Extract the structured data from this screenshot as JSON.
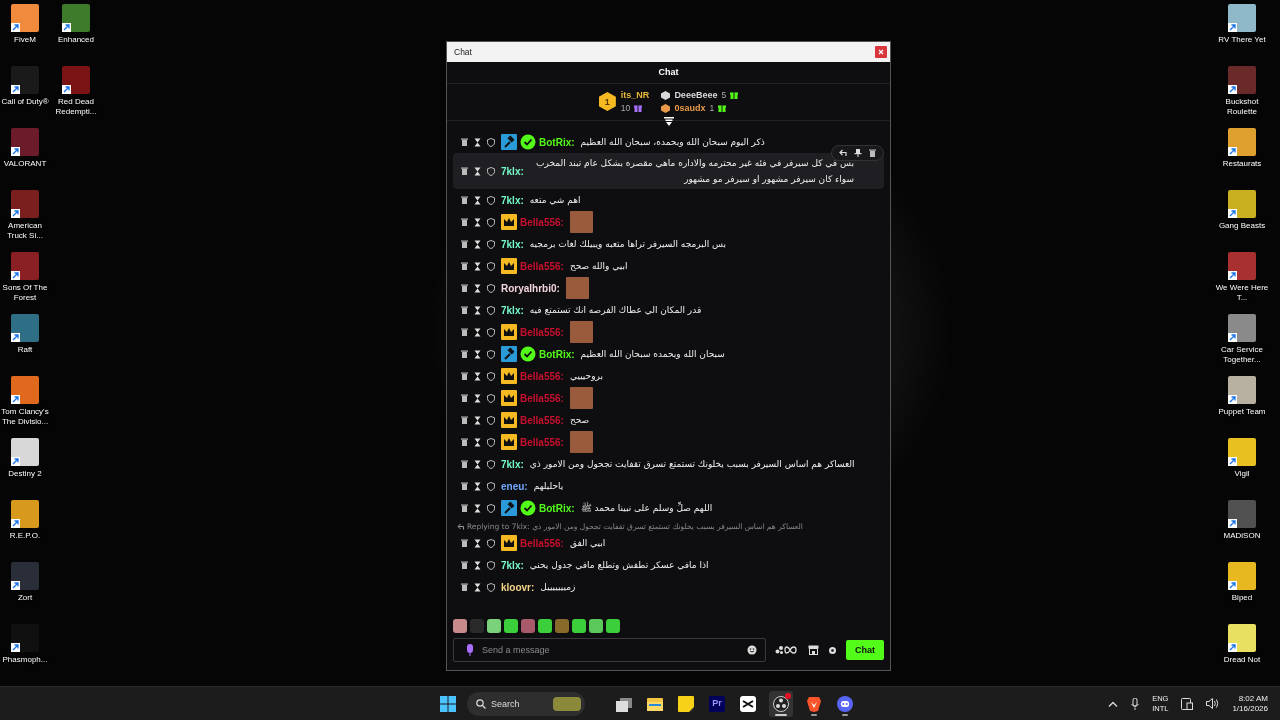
{
  "desktop": {
    "left_columns": [
      [
        {
          "label": "FiveM",
          "color": "#f08a3c"
        },
        {
          "label": "Call of Duty®",
          "color": "#1a1a1a"
        },
        {
          "label": "VALORANT",
          "color": "#6b1b2a"
        },
        {
          "label": "American Truck Si...",
          "color": "#7a1e1e"
        },
        {
          "label": "Sons Of The Forest",
          "color": "#8a1f24"
        },
        {
          "label": "Raft",
          "color": "#2e6f86"
        },
        {
          "label": "Tom Clancy's The Divisio...",
          "color": "#e0691e"
        },
        {
          "label": "Destiny 2",
          "color": "#d8d8d8"
        },
        {
          "label": "R.E.P.O.",
          "color": "#d89a1c"
        },
        {
          "label": "Zort",
          "color": "#2a2e38"
        },
        {
          "label": "Phasmoph...",
          "color": "#101010"
        }
      ],
      [
        {
          "label": "Enhanced",
          "color": "#3d7a2a"
        },
        {
          "label": "Red Dead Redempti...",
          "color": "#7a1414"
        }
      ]
    ],
    "right_column": [
      {
        "label": "RV There Yet",
        "color": "#8fb8c8"
      },
      {
        "label": "Buckshot Roulette",
        "color": "#6a2a2a"
      },
      {
        "label": "Restaurats",
        "color": "#e0a030"
      },
      {
        "label": "Gang Beasts",
        "color": "#c8b020"
      },
      {
        "label": "We Were Here T...",
        "color": "#a83030"
      },
      {
        "label": "Car Service Together...",
        "color": "#8a8a8a"
      },
      {
        "label": "Puppet Team",
        "color": "#b8b0a0"
      },
      {
        "label": "Vigil",
        "color": "#e8c020"
      },
      {
        "label": "MADiSON",
        "color": "#505050"
      },
      {
        "label": "Biped",
        "color": "#e8b820"
      },
      {
        "label": "Dread Not",
        "color": "#e8e060"
      }
    ]
  },
  "chat_window": {
    "title": "Chat",
    "heading": "Chat",
    "leaderboard": {
      "first": {
        "rank": "1",
        "name": "its_NR",
        "count": "10"
      },
      "others": [
        {
          "name": "DeeeBeee",
          "count": "5",
          "color": "#d8d8d8"
        },
        {
          "name": "0saudx",
          "count": "1",
          "color": "#e89a4a"
        }
      ]
    },
    "messages": [
      {
        "name": "BotRix:",
        "color": "#53fc18",
        "mod": true,
        "verified": true,
        "text": "ذكر اليوم سبحان الله وبحمده، سبحان الله العظيم"
      },
      {
        "name": "7klx:",
        "color": "#75fbc9",
        "text": "بس في كل سيرفر في فئه غير محترمه والاداره ماهي مقصره بشكل عام تبند المخرب سواء كان سيرفر مشهور او سيرفر مو مشهور",
        "hovered": true
      },
      {
        "name": "7klx:",
        "color": "#75fbc9",
        "text": "اهم شي متعه"
      },
      {
        "name": "Bella556:",
        "color": "#c8102e",
        "crown": true,
        "emote": true
      },
      {
        "name": "7klx:",
        "color": "#75fbc9",
        "text": "بس البرمجه السيرفر تراها متعبه ويبيلك لغات برمجيه"
      },
      {
        "name": "Bella556:",
        "color": "#c8102e",
        "crown": true,
        "text": "ابيي والله صحح"
      },
      {
        "name": "Roryalhrbi0:",
        "color": "#f2d4dc",
        "emote": true
      },
      {
        "name": "7klx:",
        "color": "#75fbc9",
        "text": "قدر المكان الي عطاك الفرصه انك تستمتع فيه"
      },
      {
        "name": "Bella556:",
        "color": "#c8102e",
        "crown": true,
        "emote": true
      },
      {
        "name": "BotRix:",
        "color": "#53fc18",
        "mod": true,
        "verified": true,
        "text": "سبحان الله وبحمده سبحان الله العظيم"
      },
      {
        "name": "Bella556:",
        "color": "#c8102e",
        "crown": true,
        "text": "بروحيييي"
      },
      {
        "name": "Bella556:",
        "color": "#c8102e",
        "crown": true,
        "emote": true
      },
      {
        "name": "Bella556:",
        "color": "#c8102e",
        "crown": true,
        "text": "صحح"
      },
      {
        "name": "Bella556:",
        "color": "#c8102e",
        "crown": true,
        "emote": true
      },
      {
        "name": "7klx:",
        "color": "#75fbc9",
        "text": "العساكر هم اساس السيرفر بسبب يخلونك تستمتع تسرق تقفايت تجحول ومن الامور ذي"
      },
      {
        "name": "eneu:",
        "color": "#6ea8fe",
        "text": "ياحليلهم"
      },
      {
        "name": "BotRix:",
        "color": "#53fc18",
        "mod": true,
        "verified": true,
        "text": "اللهم صلِّ وسلم على نبينا محمد ﷺ"
      },
      {
        "name": "Bella556:",
        "color": "#c8102e",
        "crown": true,
        "text": "ابيي الفق",
        "reply_to": "Replying to 7klx: العساكر هم اساس السيرفر بسبب يخلونك تستمتع تسرق تقفايت تجحول ومن الامور ذي"
      },
      {
        "name": "7klx:",
        "color": "#75fbc9",
        "text": "اذا مافي عسكر تطفش وتطلع مافي جدول يحني"
      },
      {
        "name": "kloovr:",
        "color": "#f5d58a",
        "text": "زميييييييل"
      }
    ],
    "emote_bar": [
      {
        "color": "#c88a8a"
      },
      {
        "color": "#2a2a2a"
      },
      {
        "color": "#7ad27a"
      },
      {
        "color": "#3ccf3c"
      },
      {
        "color": "#a85a6a"
      },
      {
        "color": "#3ccf3c"
      },
      {
        "color": "#8a6a2a"
      },
      {
        "color": "#3ccf3c"
      },
      {
        "color": "#5ac85a"
      },
      {
        "color": "#3ccf3c"
      }
    ],
    "input": {
      "placeholder": "Send a message"
    },
    "send_button": "Chat"
  },
  "taskbar": {
    "search_placeholder": "Search",
    "apps": [
      {
        "kind": "taskview"
      },
      {
        "kind": "explorer"
      },
      {
        "kind": "notes"
      },
      {
        "kind": "premiere",
        "label": "Pr"
      },
      {
        "kind": "capcut"
      },
      {
        "kind": "obs",
        "running": true,
        "active": true,
        "notification": true
      },
      {
        "kind": "brave",
        "running": true
      },
      {
        "kind": "discord",
        "running": true
      }
    ],
    "language": "ENG",
    "layout": "INTL",
    "time": "8:02 AM",
    "date": "1/16/2026"
  }
}
